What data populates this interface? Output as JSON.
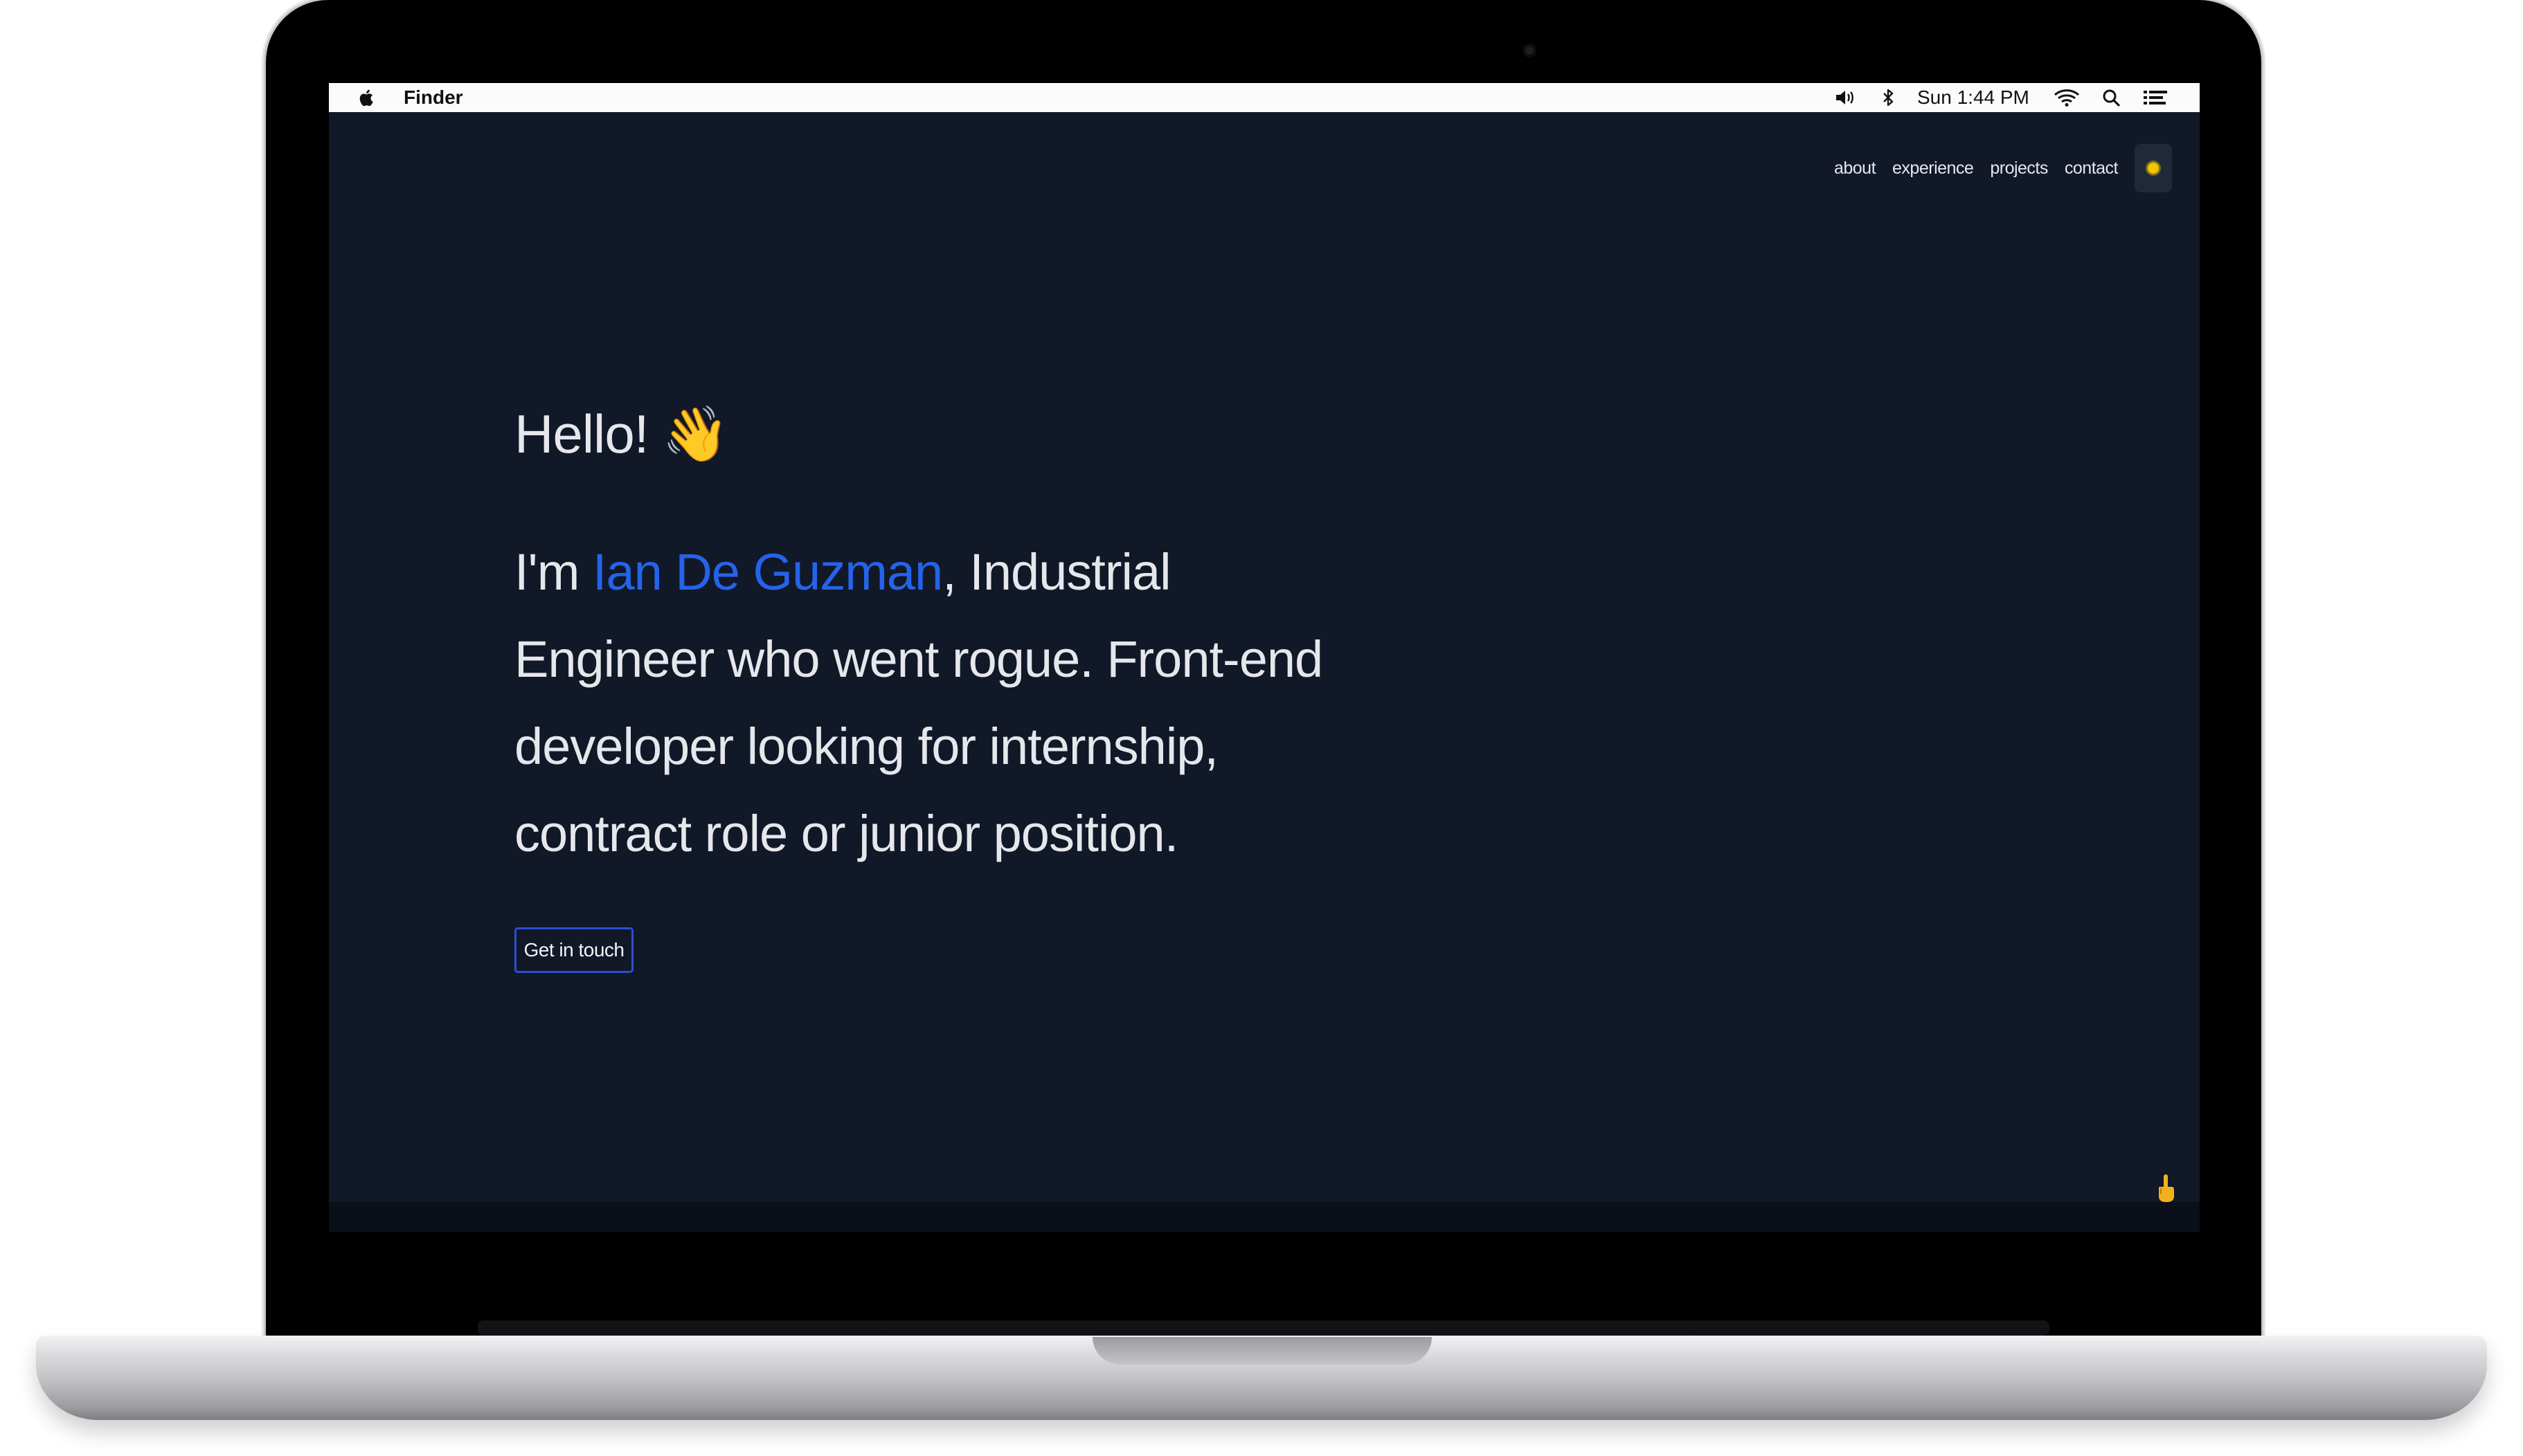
{
  "menubar": {
    "app_name": "Finder",
    "clock": "Sun 1:44 PM",
    "icons": [
      "apple-icon",
      "volume-icon",
      "bluetooth-icon",
      "wifi-icon",
      "search-icon",
      "list-icon"
    ]
  },
  "nav": {
    "items": [
      "about",
      "experience",
      "projects",
      "contact"
    ],
    "theme_toggle_icon": "sun-icon"
  },
  "hero": {
    "greeting": "Hello!",
    "greeting_emoji": "👋",
    "intro_prefix": "I'm ",
    "name": "Ian De Guzman",
    "intro_suffix": ", Industrial Engineer who went rogue. Front-end developer looking for internship, contract role or junior position.",
    "cta_label": "Get in touch"
  },
  "colors": {
    "background": "#111827",
    "accent": "#2563eb",
    "text": "#e5e7eb",
    "theme_toggle": "#f5c400"
  }
}
